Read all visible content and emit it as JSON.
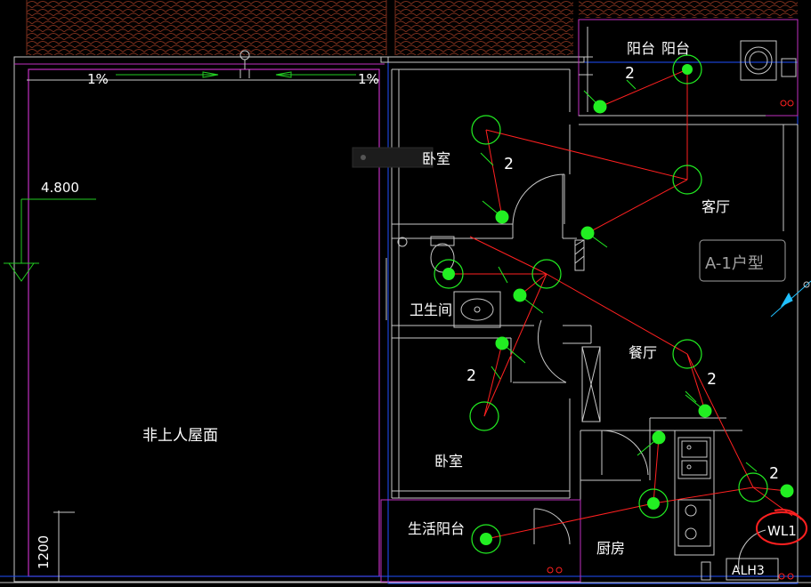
{
  "labels": {
    "slope_left": "1%",
    "slope_right": "1%",
    "elevation": "4.800",
    "roof": "非上人屋面",
    "dim_1200": "1200",
    "balcony_1": "阳台",
    "balcony_2": "阳台",
    "bedroom_top": "卧室",
    "bedroom_bottom": "卧室",
    "living_room": "客厅",
    "unit_type": "A-1户型",
    "bathroom": "卫生间",
    "dining_room": "餐厅",
    "service_balcony": "生活阳台",
    "kitchen": "厨房",
    "circuit_wl1": "WL1",
    "panel_alh3": "ALH3",
    "conductor_count_balcony": "2",
    "conductor_count_bedroom_top": "2",
    "conductor_count_bedroom_bottom": "2",
    "conductor_count_dining": "2",
    "conductor_count_kitchen": "2"
  },
  "colors": {
    "background": "#000000",
    "roof_tile": "#7a2e1c",
    "wall_magenta": "#c030c0",
    "wall_white": "#c8c8c8",
    "wiring_red": "#ff2020",
    "fixture_green": "#22ee22",
    "switch_green": "#22ff22",
    "slope_arrow_green": "#22cc22",
    "elevation_green": "#22cc22",
    "unit_label_gray": "#a0a0a0",
    "window_blue": "#2050ff",
    "highlight_circle": "#ff2020",
    "dimension_cyan": "#20c0ff"
  }
}
